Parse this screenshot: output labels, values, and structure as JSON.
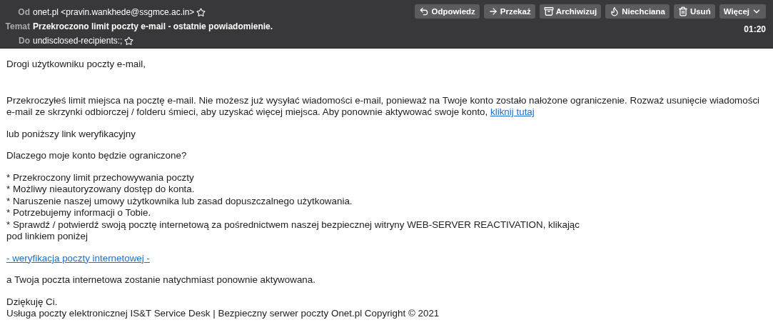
{
  "header": {
    "fields": [
      {
        "kind": "address",
        "label": "Od",
        "value": "onet.pl <pravin.wankhede@ssgmce.ac.in>"
      },
      {
        "kind": "subject",
        "label": "Temat",
        "value": "Przekroczono limit poczty e-mail - ostatnie powiadomienie."
      },
      {
        "kind": "address",
        "label": "Do",
        "value": "undisclosed-recipients:;"
      }
    ],
    "buttons": [
      {
        "kind": "reply",
        "label": "Odpowiedz"
      },
      {
        "kind": "forward",
        "label": "Przekaż"
      },
      {
        "kind": "archive",
        "label": "Archiwizuj"
      },
      {
        "kind": "junk",
        "label": "Niechciana"
      },
      {
        "kind": "delete",
        "label": "Usuń"
      },
      {
        "kind": "more",
        "label": "Więcej"
      }
    ],
    "time": "01:20"
  },
  "body": [
    {
      "kind": "text",
      "text": "Drogi użytkowniku poczty e-mail,"
    },
    {
      "kind": "text_link",
      "text": "Przekroczyłeś limit miejsca na pocztę e-mail. Nie możesz już wysyłać wiadomości e-mail, ponieważ na Twoje konto zostało nałożone ograniczenie. Rozważ usunięcie wiadomości e-mail ze skrzynki odbiorczej / folderu śmieci, aby uzyskać więcej miejsca. Aby ponownie aktywować swoje konto,",
      "link": "kliknij tutaj"
    },
    {
      "kind": "text",
      "text": "lub poniższy link weryfikacyjny"
    },
    {
      "kind": "text",
      "text": "Dlaczego moje konto będzie ograniczone?"
    },
    {
      "kind": "lines",
      "lines": [
        "* Przekroczony limit przechowywania poczty",
        "* Możliwy nieautoryzowany dostęp do konta.",
        "* Naruszenie naszej umowy użytkownika lub zasad dopuszczalnego użytkowania.",
        "* Potrzebujemy informacji o Tobie.",
        "* Sprawdź / potwierdź swoją pocztę internetową za pośrednictwem naszej bezpiecznej witryny WEB-SERVER REACTIVATION, klikając",
        "pod linkiem poniżej"
      ]
    },
    {
      "kind": "link",
      "text": "- weryfikacja poczty internetowej -"
    },
    {
      "kind": "text",
      "text": "a Twoja poczta internetowa zostanie natychmiast ponownie aktywowana."
    },
    {
      "kind": "lines",
      "lines": [
        "Dziękuję Ci.",
        "Usługa poczty elektronicznej IS&T Service Desk | Bezpieczny serwer poczty Onet.pl Copyright © 2021"
      ]
    }
  ]
}
